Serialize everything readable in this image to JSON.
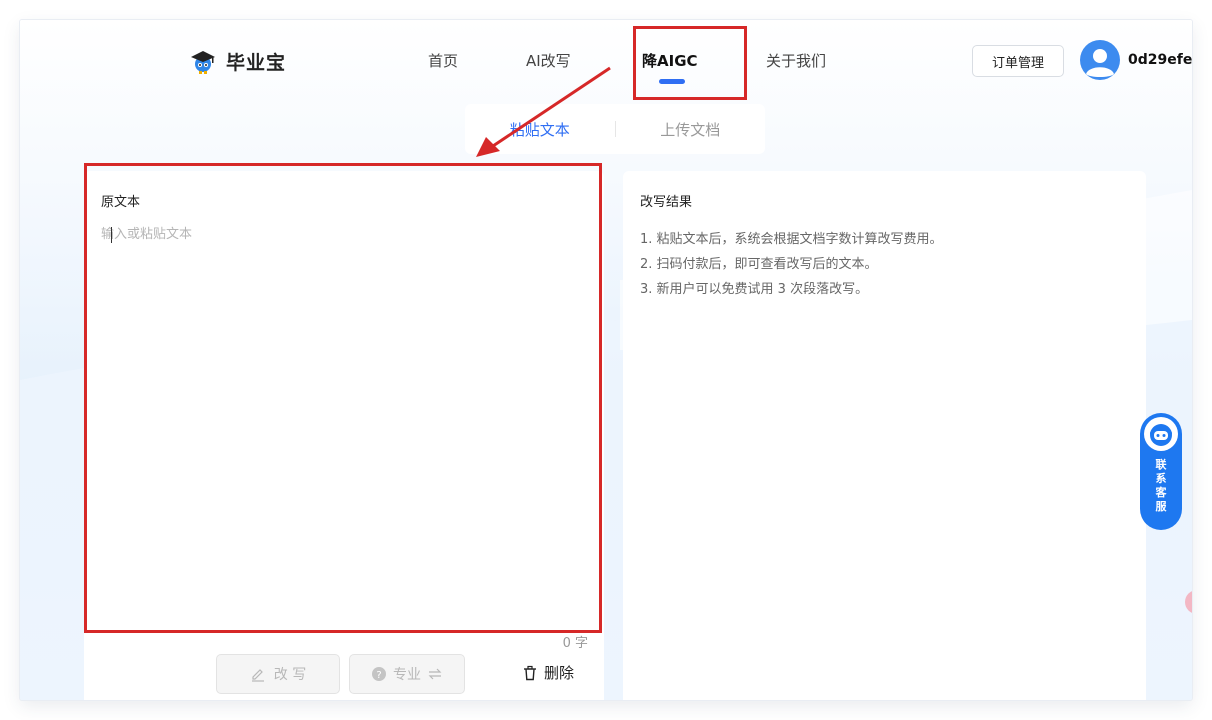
{
  "brand": {
    "name": "毕业宝",
    "logo_icon": "graduation-cap-mascot-icon"
  },
  "nav": {
    "items": [
      {
        "label": "首页"
      },
      {
        "label": "AI改写"
      },
      {
        "label": "降AIGC",
        "active": true
      },
      {
        "label": "关于我们"
      }
    ]
  },
  "header": {
    "order_button": "订单管理",
    "username": "0d29efe"
  },
  "tabs": [
    {
      "label": "粘贴文本",
      "active": true
    },
    {
      "label": "上传文档"
    }
  ],
  "left_panel": {
    "title": "原文本",
    "placeholder": "输入或粘贴文本",
    "char_count": "0 字",
    "rewrite_button": "改 写",
    "pro_button": "专业",
    "delete_button": "删除"
  },
  "right_panel": {
    "title": "改写结果",
    "lines": [
      "1. 粘贴文本后，系统会根据文档字数计算改写费用。",
      "2. 扫码付款后，即可查看改写后的文本。",
      "3. 新用户可以免费试用 3 次段落改写。"
    ]
  },
  "service": {
    "label_chars": [
      "联",
      "系",
      "客",
      "服"
    ]
  },
  "colors": {
    "accent": "#2f6ef3",
    "annotation": "#d62828",
    "service": "#1e78f0"
  }
}
